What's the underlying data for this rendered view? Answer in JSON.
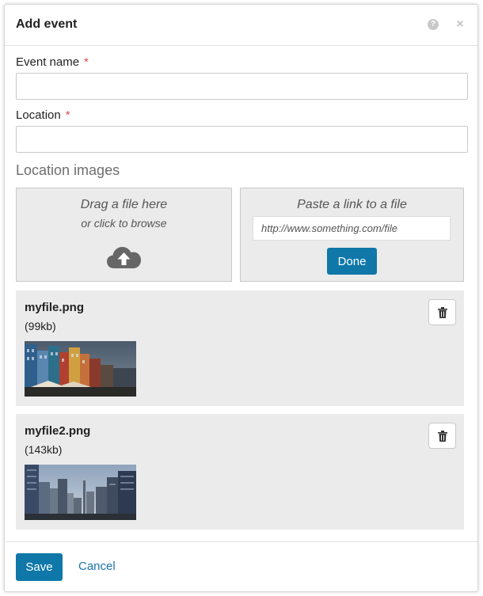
{
  "dialog": {
    "title": "Add event",
    "help_icon": "question-circle-icon",
    "close_icon": "close-icon"
  },
  "form": {
    "event_name": {
      "label": "Event name",
      "required_mark": "*",
      "value": ""
    },
    "location": {
      "label": "Location",
      "required_mark": "*",
      "value": ""
    }
  },
  "images": {
    "section_title": "Location images",
    "dropzone": {
      "line1": "Drag a file here",
      "line2": "or click to browse",
      "icon": "cloud-upload-icon"
    },
    "paste_link": {
      "title": "Paste a link to a file",
      "placeholder": "http://www.something.com/file",
      "done_label": "Done"
    },
    "files": [
      {
        "name": "myfile.png",
        "size": "(99kb)",
        "delete_icon": "trash-icon"
      },
      {
        "name": "myfile2.png",
        "size": "(143kb)",
        "delete_icon": "trash-icon"
      }
    ]
  },
  "footer": {
    "save_label": "Save",
    "cancel_label": "Cancel"
  },
  "colors": {
    "primary": "#0f78a8",
    "link": "#1a73ad",
    "required": "#d9534f",
    "panel_bg": "#ebebeb"
  }
}
